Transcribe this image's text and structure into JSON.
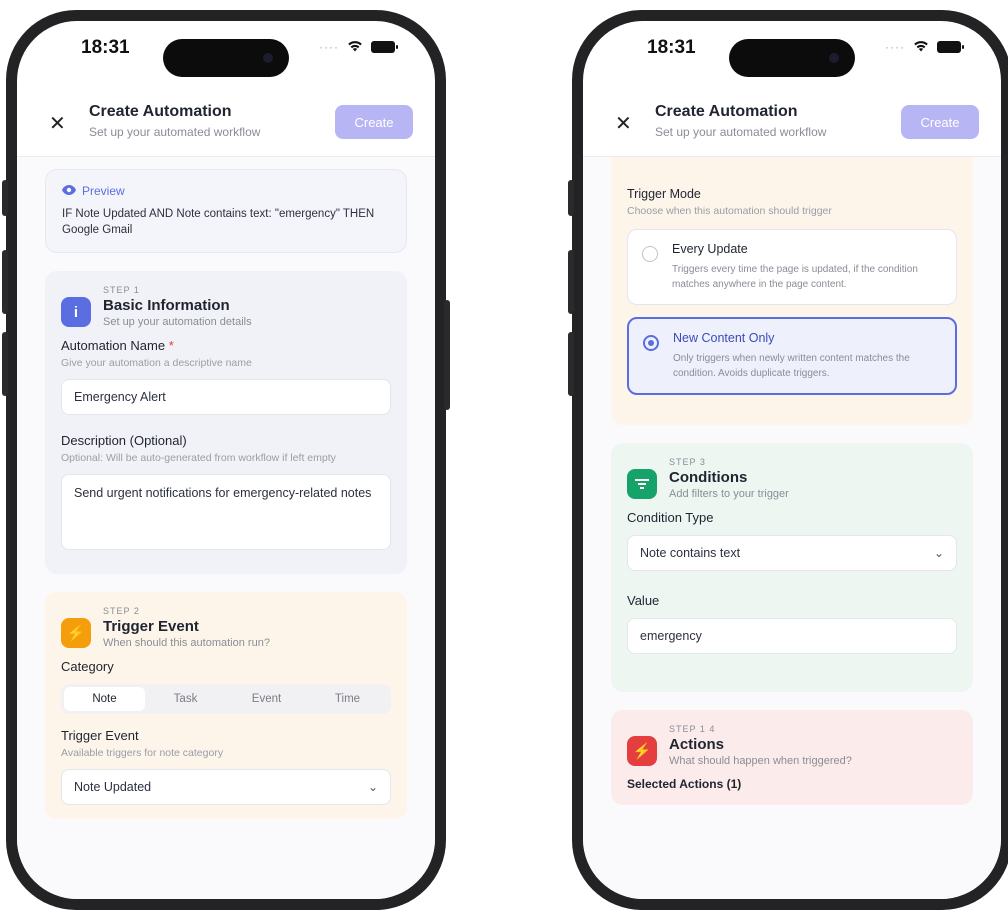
{
  "left": {
    "status": {
      "time": "18:31"
    },
    "header": {
      "title": "Create Automation",
      "subtitle": "Set up your automated workflow",
      "create_label": "Create"
    },
    "preview": {
      "label": "Preview",
      "text": "IF Note Updated AND Note contains text: \"emergency\" THEN Google Gmail"
    },
    "step1": {
      "step": "STEP 1",
      "title": "Basic Information",
      "subtitle": "Set up your automation details",
      "name_label": "Automation Name",
      "required_mark": "*",
      "name_hint": "Give your automation a descriptive name",
      "name_value": "Emergency Alert",
      "desc_label": "Description (Optional)",
      "desc_hint": "Optional: Will be auto-generated from workflow if left empty",
      "desc_value": "Send urgent notifications for emergency-related notes"
    },
    "step2": {
      "step": "STEP 2",
      "title": "Trigger Event",
      "subtitle": "When should this automation run?",
      "category_label": "Category",
      "categories": [
        "Note",
        "Task",
        "Event",
        "Time"
      ],
      "trigger_label": "Trigger Event",
      "trigger_hint": "Available triggers for note category",
      "trigger_value": "Note Updated"
    }
  },
  "right": {
    "status": {
      "time": "18:31"
    },
    "header": {
      "title": "Create Automation",
      "subtitle": "Set up your automated workflow",
      "create_label": "Create"
    },
    "trigger_mode": {
      "label": "Trigger Mode",
      "hint": "Choose when this automation should trigger",
      "options": [
        {
          "title": "Every Update",
          "desc": "Triggers every time the page is updated, if the condition matches anywhere in the page content."
        },
        {
          "title": "New Content Only",
          "desc": "Only triggers when newly written content matches the condition. Avoids duplicate triggers."
        }
      ]
    },
    "step3": {
      "step": "STEP 3",
      "title": "Conditions",
      "subtitle": "Add filters to your trigger",
      "type_label": "Condition Type",
      "type_value": "Note contains text",
      "value_label": "Value",
      "value_value": "emergency"
    },
    "step4": {
      "step": "STEP 1 4",
      "title": "Actions",
      "subtitle": "What should happen when triggered?",
      "selected_label": "Selected Actions (1)"
    }
  },
  "colors": {
    "accent": "#5b6ee1",
    "create_button": "#b8b5f5",
    "step1_icon": "#5b6ee1",
    "step2_icon": "#f59e0b",
    "step3_icon": "#16a36a",
    "step4_icon": "#e53e3e"
  }
}
